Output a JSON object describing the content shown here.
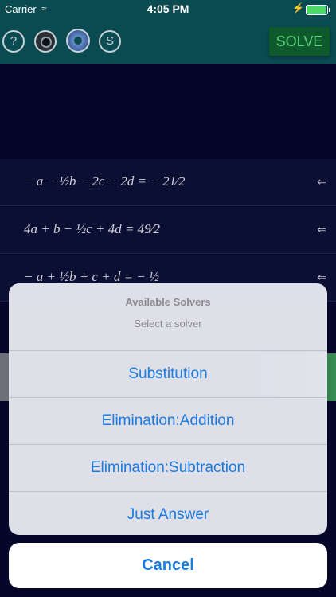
{
  "status_bar": {
    "carrier": "Carrier",
    "time": "4:05 PM"
  },
  "toolbar": {
    "help_label": "?",
    "solver_label": "S",
    "solve_label": "SOLVE",
    "icons": [
      "help-icon",
      "camera-icon",
      "settings-icon",
      "solver-icon"
    ]
  },
  "equations": [
    {
      "text": "− a − ½b − 2c − 2d = − 21⁄2"
    },
    {
      "text": "4a + b − ½c + 4d = 49⁄2"
    },
    {
      "text": "− a + ½b + c + d = − ½"
    }
  ],
  "sheet": {
    "title": "Available Solvers",
    "message": "Select a solver",
    "options": [
      "Substitution",
      "Elimination:Addition",
      "Elimination:Subtraction",
      "Just Answer"
    ],
    "cancel": "Cancel"
  },
  "colors": {
    "accent": "#1a7be0",
    "toolbar": "#0a4b52",
    "solve_button": "#0f5a2c",
    "background": "#05062a"
  }
}
